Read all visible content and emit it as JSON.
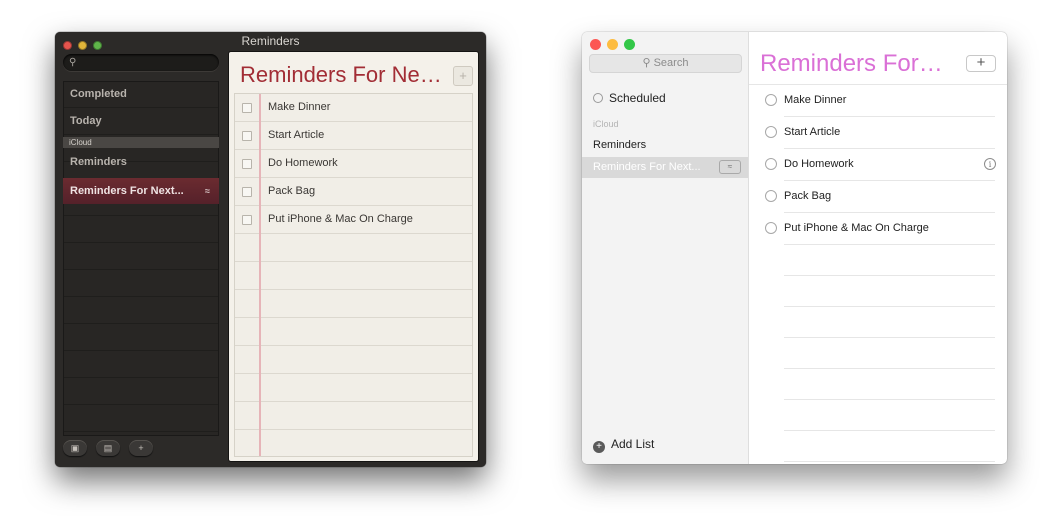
{
  "old_window": {
    "title": "Reminders",
    "search_placeholder": "",
    "sidebar": {
      "completed": "Completed",
      "today": "Today",
      "section": "iCloud",
      "reminders": "Reminders",
      "selected": "Reminders For Next...",
      "share_icon": "broadcast-icon"
    },
    "list_title": "Reminders For Ne…",
    "add_label": "+",
    "items": [
      "Make Dinner",
      "Start Article",
      "Do Homework",
      "Pack Bag",
      "Put iPhone & Mac On Charge"
    ],
    "bottom_buttons": [
      "▣",
      "▤",
      "+"
    ],
    "title_color": "#a22d35",
    "selected_color": "#6b2b30"
  },
  "new_window": {
    "search": "Search",
    "sidebar": {
      "scheduled": "Scheduled",
      "section": "iCloud",
      "reminders": "Reminders",
      "selected": "Reminders For Next...",
      "add_list": "Add List"
    },
    "list_title": "Reminders For…",
    "add_label": "+",
    "items": [
      "Make Dinner",
      "Start Article",
      "Do Homework",
      "Pack Bag",
      "Put iPhone & Mac On Charge"
    ],
    "info_label": "i",
    "title_color": "#da70d6"
  }
}
